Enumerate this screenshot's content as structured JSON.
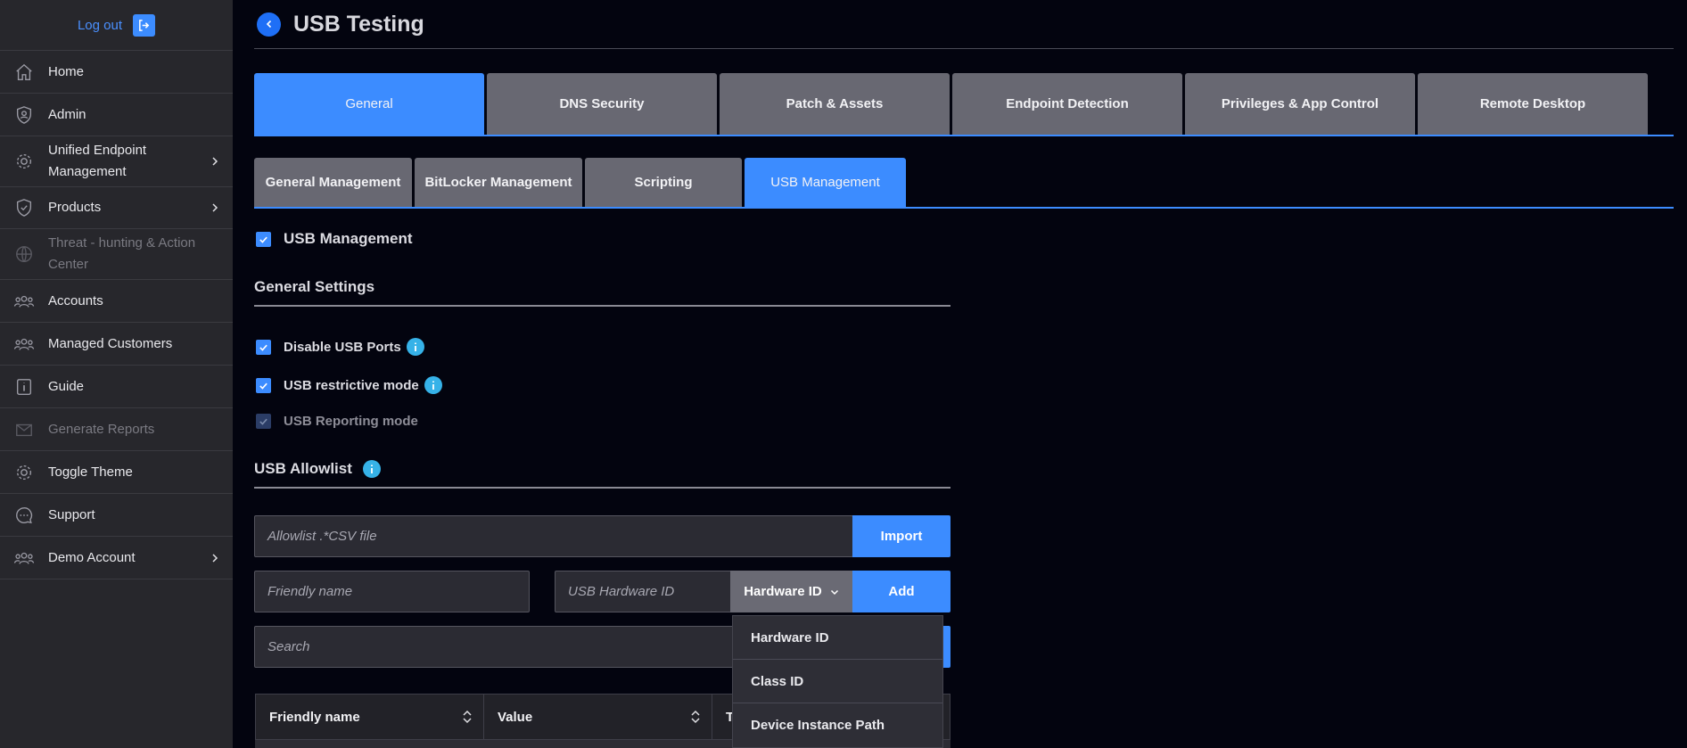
{
  "sidebar": {
    "logout_label": "Log out",
    "items": [
      {
        "label": "Home",
        "icon": "home-icon",
        "disabled": false,
        "chevron": false
      },
      {
        "label": "Admin",
        "icon": "user-shield-icon",
        "disabled": false,
        "chevron": false
      },
      {
        "label": "Unified Endpoint Management",
        "icon": "gear-icon",
        "disabled": false,
        "chevron": true
      },
      {
        "label": "Products",
        "icon": "shield-icon",
        "disabled": false,
        "chevron": true
      },
      {
        "label": "Threat - hunting & Action Center",
        "icon": "globe-icon",
        "disabled": true,
        "chevron": false
      },
      {
        "label": "Accounts",
        "icon": "users-icon",
        "disabled": false,
        "chevron": false
      },
      {
        "label": "Managed Customers",
        "icon": "users-icon",
        "disabled": false,
        "chevron": false
      },
      {
        "label": "Guide",
        "icon": "info-box-icon",
        "disabled": false,
        "chevron": false
      },
      {
        "label": "Generate Reports",
        "icon": "mail-icon",
        "disabled": true,
        "chevron": false
      },
      {
        "label": "Toggle Theme",
        "icon": "gear-icon",
        "disabled": false,
        "chevron": false
      },
      {
        "label": "Support",
        "icon": "chat-icon",
        "disabled": false,
        "chevron": false
      },
      {
        "label": "Demo Account",
        "icon": "users-icon",
        "disabled": false,
        "chevron": true
      }
    ]
  },
  "header": {
    "title": "USB Testing"
  },
  "top_tabs": [
    {
      "label": "General",
      "active": true
    },
    {
      "label": "DNS Security",
      "active": false
    },
    {
      "label": "Patch & Assets",
      "active": false
    },
    {
      "label": "Endpoint Detection",
      "active": false
    },
    {
      "label": "Privileges & App Control",
      "active": false
    },
    {
      "label": "Remote Desktop",
      "active": false
    }
  ],
  "sub_tabs": [
    {
      "label": "General Management",
      "active": false
    },
    {
      "label": "BitLocker Management",
      "active": false
    },
    {
      "label": "Scripting",
      "active": false
    },
    {
      "label": "USB Management",
      "active": true
    }
  ],
  "usb_management": {
    "label": "USB Management",
    "checked": true
  },
  "general_settings": {
    "title": "General Settings",
    "options": [
      {
        "label": "Disable USB Ports",
        "checked": true,
        "info": true,
        "disabled": false
      },
      {
        "label": "USB restrictive mode",
        "checked": true,
        "info": true,
        "disabled": false
      },
      {
        "label": "USB Reporting mode",
        "checked": true,
        "info": false,
        "disabled": true
      }
    ]
  },
  "allowlist": {
    "title": "USB Allowlist",
    "file_placeholder": "Allowlist .*CSV file",
    "import_label": "Import",
    "friendly_name_placeholder": "Friendly name",
    "hardware_id_placeholder": "USB Hardware ID",
    "type_selected": "Hardware ID",
    "add_label": "Add",
    "search_placeholder": "Search",
    "dropdown_options": [
      "Hardware ID",
      "Class ID",
      "Device Instance Path"
    ],
    "columns": [
      "Friendly name",
      "Value",
      "T"
    ]
  },
  "colors": {
    "accent": "#3c8cff",
    "info": "#36b2e8",
    "sidebar": "#27272c",
    "background": "#03040f"
  }
}
